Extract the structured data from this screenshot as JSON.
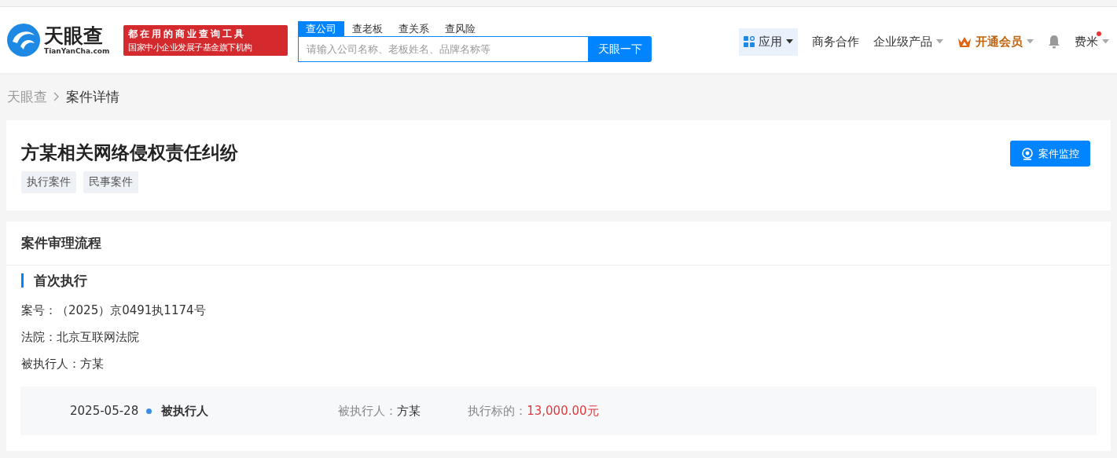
{
  "header": {
    "logo": {
      "name": "天眼查",
      "domain": "TianYanCha.com"
    },
    "slogan": [
      "都在用的商业查询工具",
      "国家中小企业发展子基金旗下机构"
    ],
    "search": {
      "tabs": [
        {
          "label": "查公司",
          "selected": true
        },
        {
          "label": "查老板",
          "selected": false
        },
        {
          "label": "查关系",
          "selected": false
        },
        {
          "label": "查风险",
          "selected": false
        }
      ],
      "placeholder": "请输入公司名称、老板姓名、品牌名称等",
      "button": "天眼一下"
    },
    "nav": [
      {
        "kind": "apps",
        "label": "应用"
      },
      {
        "kind": "link",
        "label": "商务合作"
      },
      {
        "kind": "dropdown",
        "label": "企业级产品"
      },
      {
        "kind": "vip",
        "label": "开通会员"
      },
      {
        "kind": "bell"
      },
      {
        "kind": "user",
        "label": "费米",
        "unread": true
      }
    ]
  },
  "breadcrumb": [
    "天眼查",
    "案件详情"
  ],
  "case": {
    "title": "方某相关网络侵权责任纠纷",
    "tags": [
      "执行案件",
      "民事案件"
    ],
    "monitor_button": "案件监控"
  },
  "process": {
    "heading": "案件审理流程",
    "stage": "首次执行",
    "fields": [
      {
        "label": "案号：",
        "value": "（2025）京0491执1174号"
      },
      {
        "label": "法院：",
        "value": "北京互联网法院"
      },
      {
        "label": "被执行人：",
        "value": "方某"
      }
    ],
    "timeline": [
      {
        "date": "2025-05-28",
        "role": "被执行人",
        "party_label": "被执行人：",
        "party": "方某",
        "amount_label": "执行标的：",
        "amount": "13,000.00元"
      }
    ]
  }
}
